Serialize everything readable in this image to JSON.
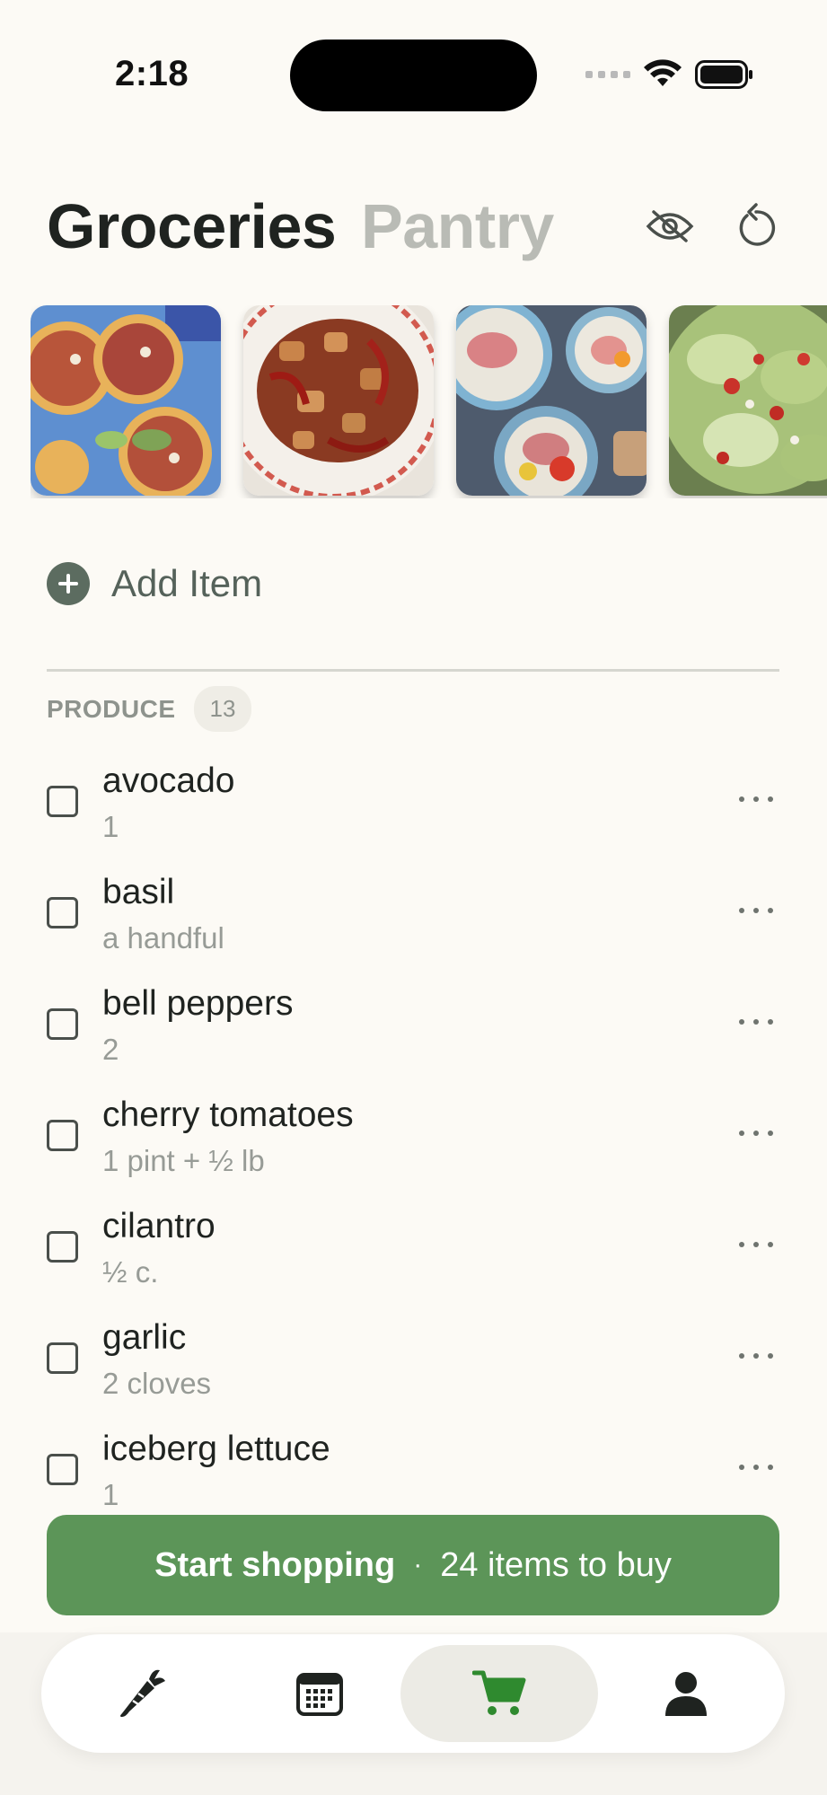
{
  "status_bar": {
    "time": "2:18"
  },
  "header": {
    "tabs": [
      {
        "label": "Groceries",
        "active": true
      },
      {
        "label": "Pantry",
        "active": false
      }
    ],
    "icons": [
      "hide-eye-icon",
      "refresh-icon"
    ]
  },
  "recipes": {
    "thumbnails": [
      {
        "icon": "tostadas-thumbnail"
      },
      {
        "icon": "kung-pao-chicken-thumbnail"
      },
      {
        "icon": "prosciutto-salad-thumbnail"
      },
      {
        "icon": "green-salad-thumbnail"
      }
    ]
  },
  "add_item": {
    "label": "Add Item"
  },
  "section": {
    "title": "PRODUCE",
    "count": "13"
  },
  "items": [
    {
      "name": "avocado",
      "qty": "1"
    },
    {
      "name": "basil",
      "qty": "a handful"
    },
    {
      "name": "bell peppers",
      "qty": "2"
    },
    {
      "name": "cherry tomatoes",
      "qty": "1 pint + ½ lb"
    },
    {
      "name": "cilantro",
      "qty": "½ c."
    },
    {
      "name": "garlic",
      "qty": "2 cloves"
    },
    {
      "name": "iceberg lettuce",
      "qty": "1"
    }
  ],
  "cta": {
    "primary": "Start shopping",
    "separator": "·",
    "secondary": "24 items to buy"
  },
  "tabbar": {
    "items": [
      {
        "icon": "carrot-icon",
        "active": false
      },
      {
        "icon": "calendar-icon",
        "active": false
      },
      {
        "icon": "cart-icon",
        "active": true
      },
      {
        "icon": "person-icon",
        "active": false
      }
    ]
  },
  "colors": {
    "background": "#fcfaf5",
    "accent_green": "#5c9558",
    "cart_active": "#2f8a2f",
    "muted": "#979b96"
  }
}
